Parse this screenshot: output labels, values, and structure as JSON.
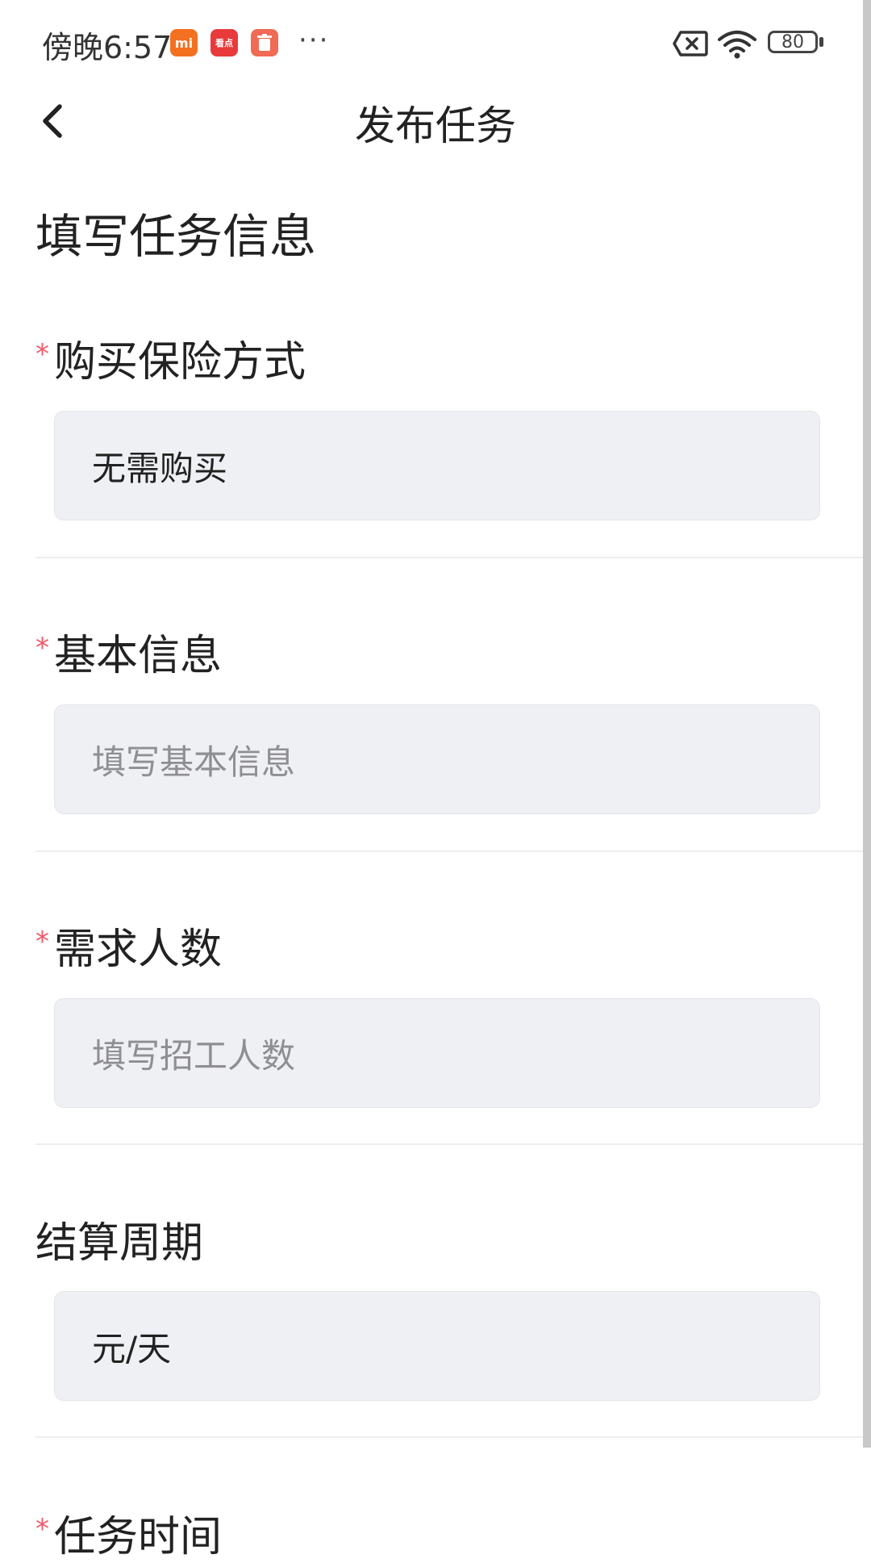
{
  "status_bar": {
    "time": "傍晚6:57",
    "notif_icons": [
      "mi-icon",
      "kandian-icon",
      "trash-icon"
    ],
    "mi_label": "mi",
    "kandian_label": "看点",
    "more": "···",
    "battery": "80"
  },
  "nav": {
    "title": "发布任务"
  },
  "form": {
    "section_title": "填写任务信息",
    "required_mark": "*",
    "insurance": {
      "label": "购买保险方式",
      "value": "无需购买"
    },
    "basic_info": {
      "label": "基本信息",
      "placeholder": "填写基本信息"
    },
    "headcount": {
      "label": "需求人数",
      "placeholder": "填写招工人数"
    },
    "settlement": {
      "label": "结算周期",
      "value": "元/天"
    },
    "task_time": {
      "label": "任务时间"
    }
  },
  "colors": {
    "required": "#f05a6a",
    "field_bg": "#eff0f4",
    "placeholder": "#8e8e93"
  }
}
